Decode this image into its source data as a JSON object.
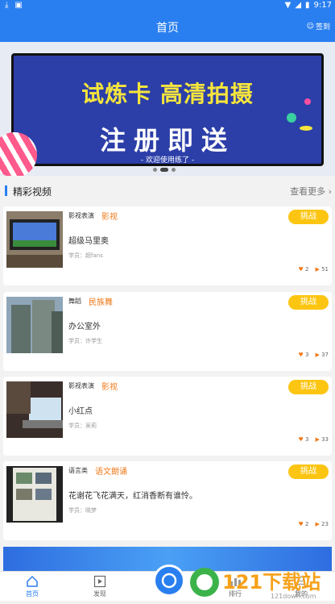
{
  "status_bar": {
    "time": "9:17",
    "left_icons": [
      "download-icon",
      "notification-icon"
    ]
  },
  "nav": {
    "title": "首页",
    "signin_label": "签到"
  },
  "banner": {
    "line1": "试炼卡 高清拍摄",
    "line2": "注册即送",
    "line3": "- 欢迎使用练了 -"
  },
  "section": {
    "title": "精彩视频",
    "more_label": "查看更多"
  },
  "cards": [
    {
      "category": "影视表演",
      "tag": "影视",
      "title": "超级马里奥",
      "student": "学员：超fans",
      "button": "挑战",
      "likes": "2",
      "plays": "51"
    },
    {
      "category": "舞蹈",
      "tag": "民族舞",
      "title": "办公室外",
      "student": "学员：许学生",
      "button": "挑战",
      "likes": "3",
      "plays": "37"
    },
    {
      "category": "影视表演",
      "tag": "影视",
      "title": "小红点",
      "student": "学员：吴莉",
      "button": "挑战",
      "likes": "3",
      "plays": "33"
    },
    {
      "category": "语言类",
      "tag": "语文朗诵",
      "title": "花谢花飞花满天，红消香断有谁怜。",
      "student": "学员：晓梦",
      "button": "挑战",
      "likes": "2",
      "plays": "23"
    }
  ],
  "tabs": [
    {
      "label": "首页",
      "icon": "home-icon"
    },
    {
      "label": "发现",
      "icon": "video-icon"
    },
    {
      "label": "排行",
      "icon": "chart-icon"
    },
    {
      "label": "我的",
      "icon": "user-icon"
    }
  ],
  "watermark": {
    "text": "121下载站",
    "sub": "121down.com"
  },
  "colors": {
    "primary": "#2a7ff0",
    "accent": "#f07a1a",
    "button": "#fcc512"
  }
}
